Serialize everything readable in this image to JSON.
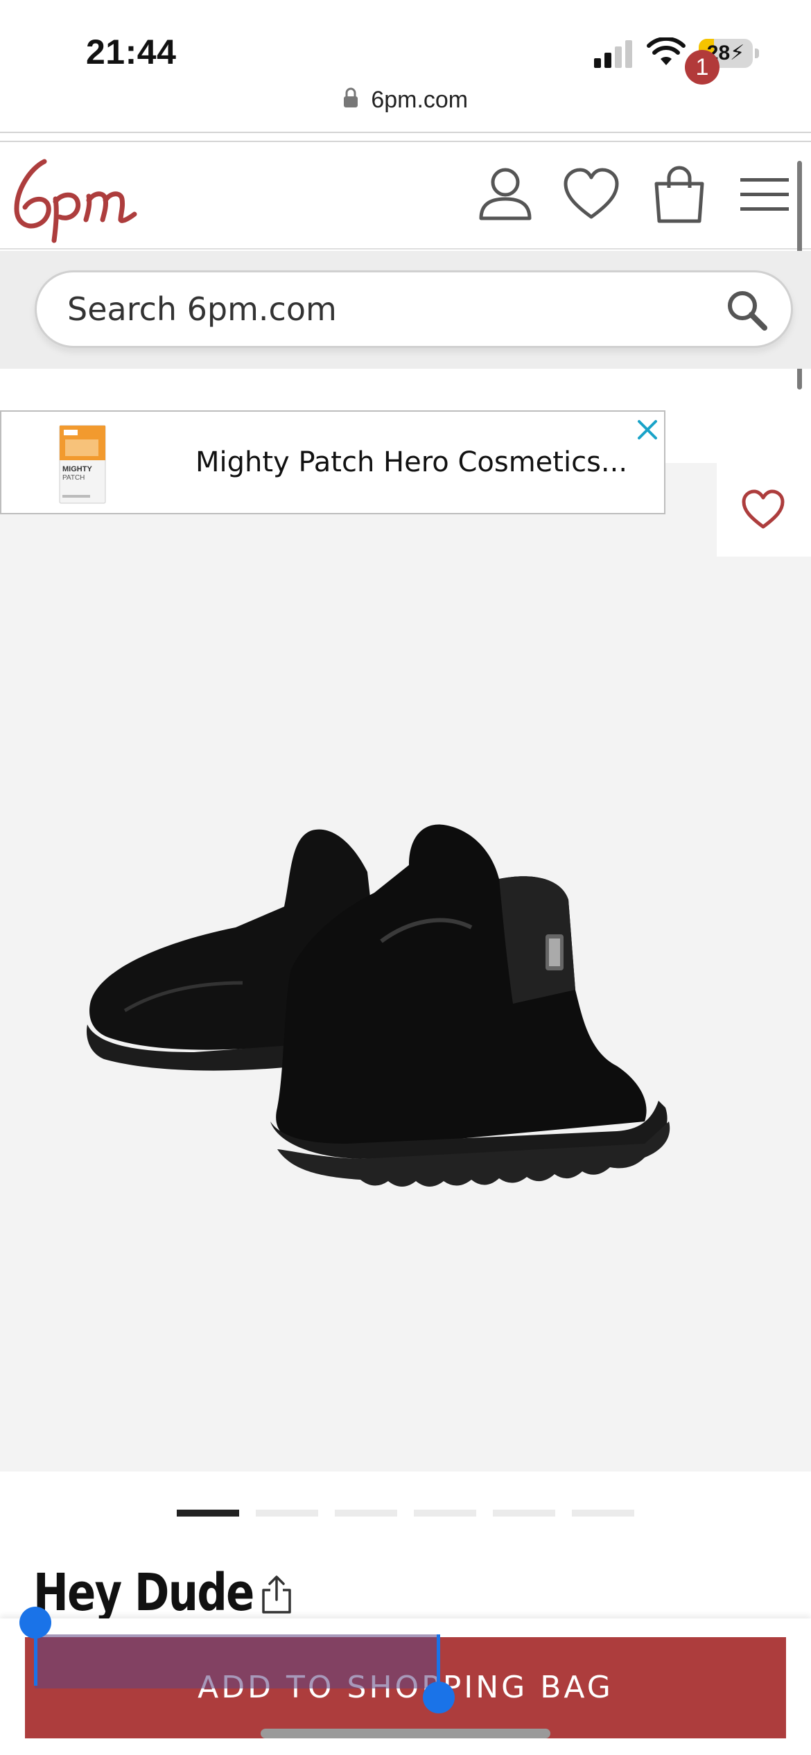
{
  "status_bar": {
    "time": "21:44",
    "battery_text": "28",
    "battery_level": 0.28,
    "battery_color": "#f5c400",
    "icons": [
      "signal-icon",
      "wifi-icon",
      "battery-icon"
    ]
  },
  "browser": {
    "url": "6pm.com",
    "lock_icon": "lock-icon"
  },
  "header": {
    "logo_text": "6pm",
    "brand_color": "#ad3d3d",
    "icons": [
      "account-icon",
      "heart-icon",
      "shopping-bag-icon",
      "hamburger-menu-icon"
    ],
    "bag_count": "1"
  },
  "search": {
    "placeholder": "Search 6pm.com",
    "value": "",
    "icon": "search-icon"
  },
  "ad": {
    "text": "Mighty Patch Hero Cosmetics...",
    "thumbnail_label": "MIGHTY PATCH",
    "close_icon": "close-icon",
    "close_color": "#1aa3c8"
  },
  "product": {
    "image_description_icon": "product-image",
    "brand": "Hey Dude",
    "share_icon": "share-icon",
    "wishlist_icon": "heart-icon"
  },
  "carousel": {
    "total": 6,
    "active_index": 0
  },
  "actions": {
    "add_to_bag_label": "ADD TO SHOPPING BAG"
  }
}
